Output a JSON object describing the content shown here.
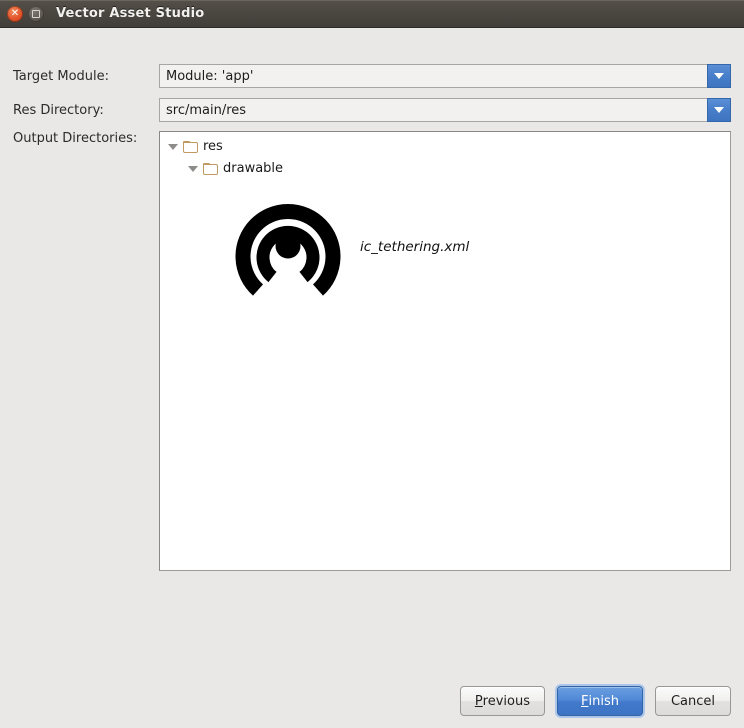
{
  "window": {
    "title": "Vector Asset Studio",
    "close_icon": "close-icon",
    "maximize_icon": "maximize-icon"
  },
  "form": {
    "target_module": {
      "label": "Target Module:",
      "value": "Module: 'app'",
      "arrow_icon": "chevron-down-icon"
    },
    "res_directory": {
      "label": "Res Directory:",
      "value": "src/main/res",
      "arrow_icon": "chevron-down-icon"
    },
    "output_directories": {
      "label": "Output Directories:"
    }
  },
  "tree": {
    "nodes": [
      {
        "label": "res",
        "icon": "folder-icon",
        "expanded": true,
        "depth": 0
      },
      {
        "label": "drawable",
        "icon": "folder-icon",
        "expanded": true,
        "depth": 1
      }
    ]
  },
  "preview": {
    "icon_name": "tethering-icon",
    "file_name": "ic_tethering.xml"
  },
  "footer": {
    "previous": {
      "label": "Previous",
      "mnemonic": "P",
      "rest": "revious"
    },
    "finish": {
      "label": "Finish",
      "mnemonic": "F",
      "rest": "inish"
    },
    "cancel": {
      "label": "Cancel"
    }
  },
  "colors": {
    "titlebar": "#4b4741",
    "dialog_bg": "#e9e8e7",
    "accent_blue": "#4179cb",
    "combo_arrow_blue": "#477ec9",
    "folder_tan": "#c09a62",
    "close_orange": "#e2542a"
  }
}
